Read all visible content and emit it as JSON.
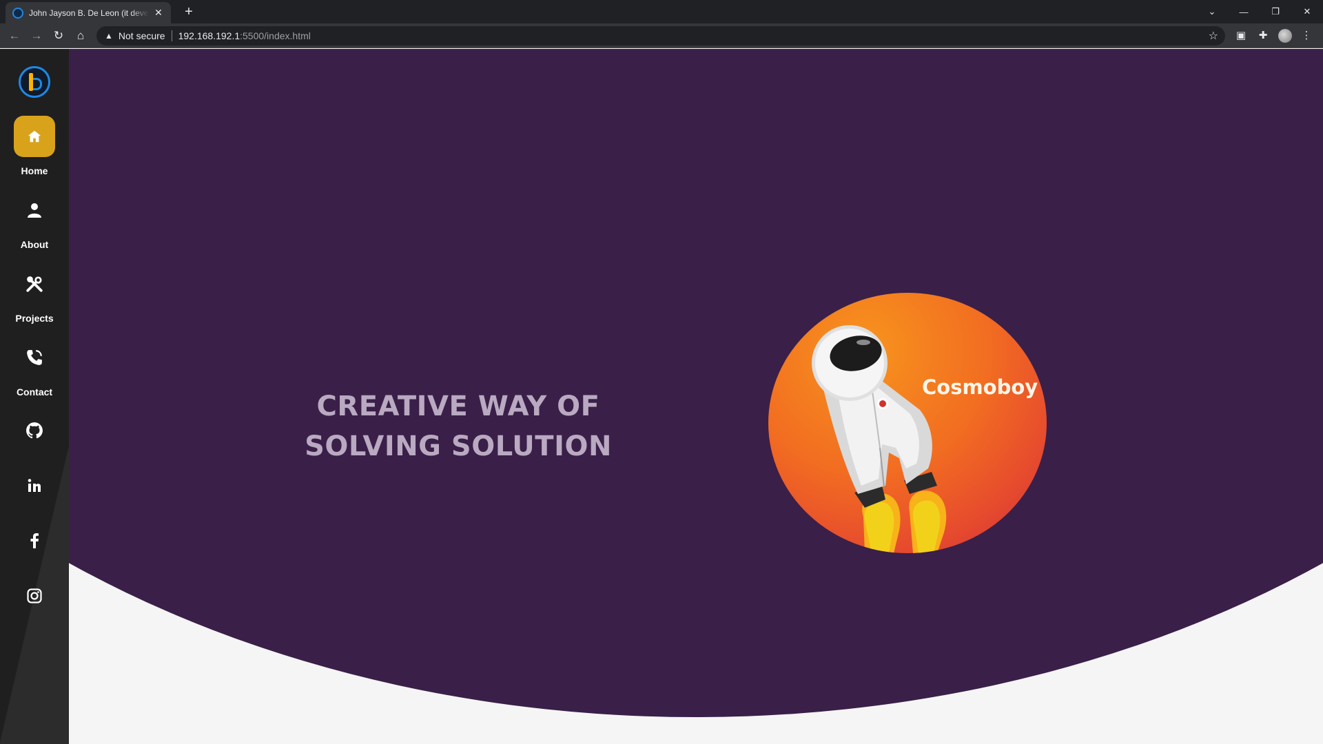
{
  "browser": {
    "tab_title": "John Jayson B. De Leon (it developer)",
    "new_tab_label": "+",
    "security_label": "Not secure",
    "url_host": "192.168.192.1",
    "url_path": ":5500/index.html"
  },
  "sidebar": {
    "nav": [
      {
        "label": "Home",
        "icon": "home-icon",
        "active": true
      },
      {
        "label": "About",
        "icon": "user-icon",
        "active": false
      },
      {
        "label": "Projects",
        "icon": "tools-icon",
        "active": false
      },
      {
        "label": "Contact",
        "icon": "phone-icon",
        "active": false
      }
    ],
    "social": [
      "github-icon",
      "linkedin-icon",
      "facebook-icon",
      "instagram-icon"
    ]
  },
  "hero": {
    "headline_line1": "CREATIVE WAY OF",
    "headline_line2": "SOLVING SOLUTION",
    "brand_name": "Cosmoboy"
  },
  "colors": {
    "hero_bg": "#3a1f49",
    "sidebar_bg": "#1f1f1f",
    "active_nav": "#d9a21b",
    "page_bg": "#f5f5f5"
  }
}
